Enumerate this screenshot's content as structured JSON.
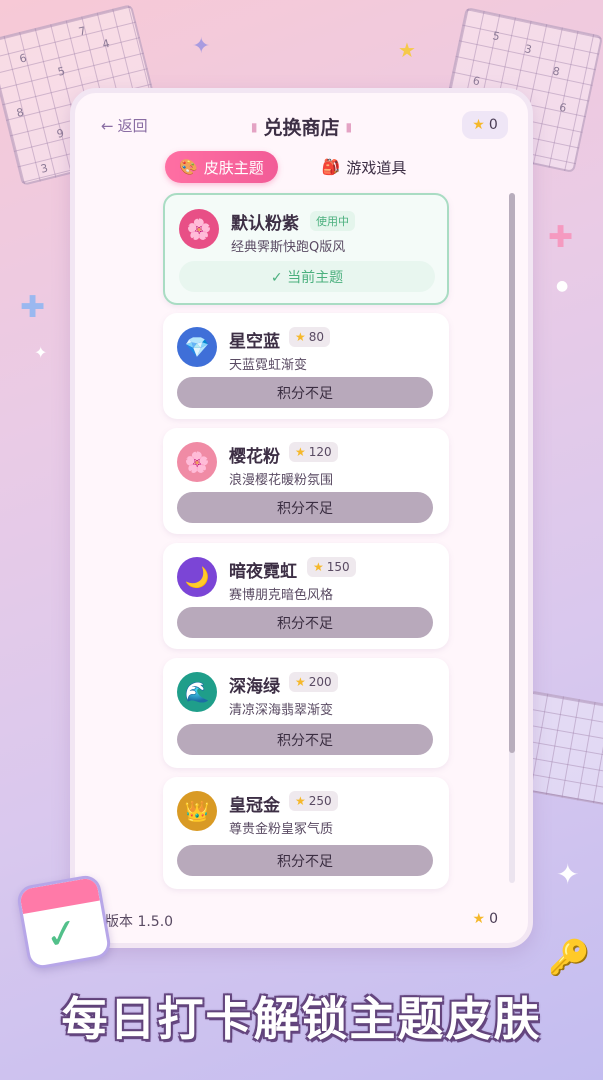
{
  "header": {
    "back_label": "返回",
    "title": "兑换商店",
    "points": "0"
  },
  "tabs": [
    {
      "icon": "🎨",
      "label": "皮肤主题",
      "active": true
    },
    {
      "icon": "🎒",
      "label": "游戏道具",
      "active": false
    }
  ],
  "skins": [
    {
      "name": "默认粉紫",
      "badge": "使用中",
      "desc": "经典霁斯快跑Q版风",
      "button": "✓ 当前主题",
      "icon": "🌸",
      "color": "#e84f86",
      "current": true
    },
    {
      "name": "星空蓝",
      "price": "80",
      "desc": "天蓝霓虹渐变",
      "button": "积分不足",
      "icon": "💎",
      "color": "#3f6fd8",
      "current": false
    },
    {
      "name": "樱花粉",
      "price": "120",
      "desc": "浪漫樱花暖粉氛围",
      "button": "积分不足",
      "icon": "🌸",
      "color": "#f08ba5",
      "current": false
    },
    {
      "name": "暗夜霓虹",
      "price": "150",
      "desc": "赛博朋克暗色风格",
      "button": "积分不足",
      "icon": "🌙",
      "color": "#7b45d6",
      "current": false
    },
    {
      "name": "深海绿",
      "price": "200",
      "desc": "清凉深海翡翠渐变",
      "button": "积分不足",
      "icon": "🌊",
      "color": "#1f9e8a",
      "current": false
    },
    {
      "name": "皇冠金",
      "price": "250",
      "desc": "尊贵金粉皇冢气质",
      "button": "积分不足",
      "icon": "👑",
      "color": "#d99a24",
      "current": false
    }
  ],
  "footer": {
    "version": "版本 1.5.0",
    "points": "0"
  },
  "banner": "每日打卡解锁主题皮肤",
  "colors": {
    "accent": "#f25c97",
    "locked_button": "#b8a9bb",
    "current_green": "#4bb07e"
  }
}
